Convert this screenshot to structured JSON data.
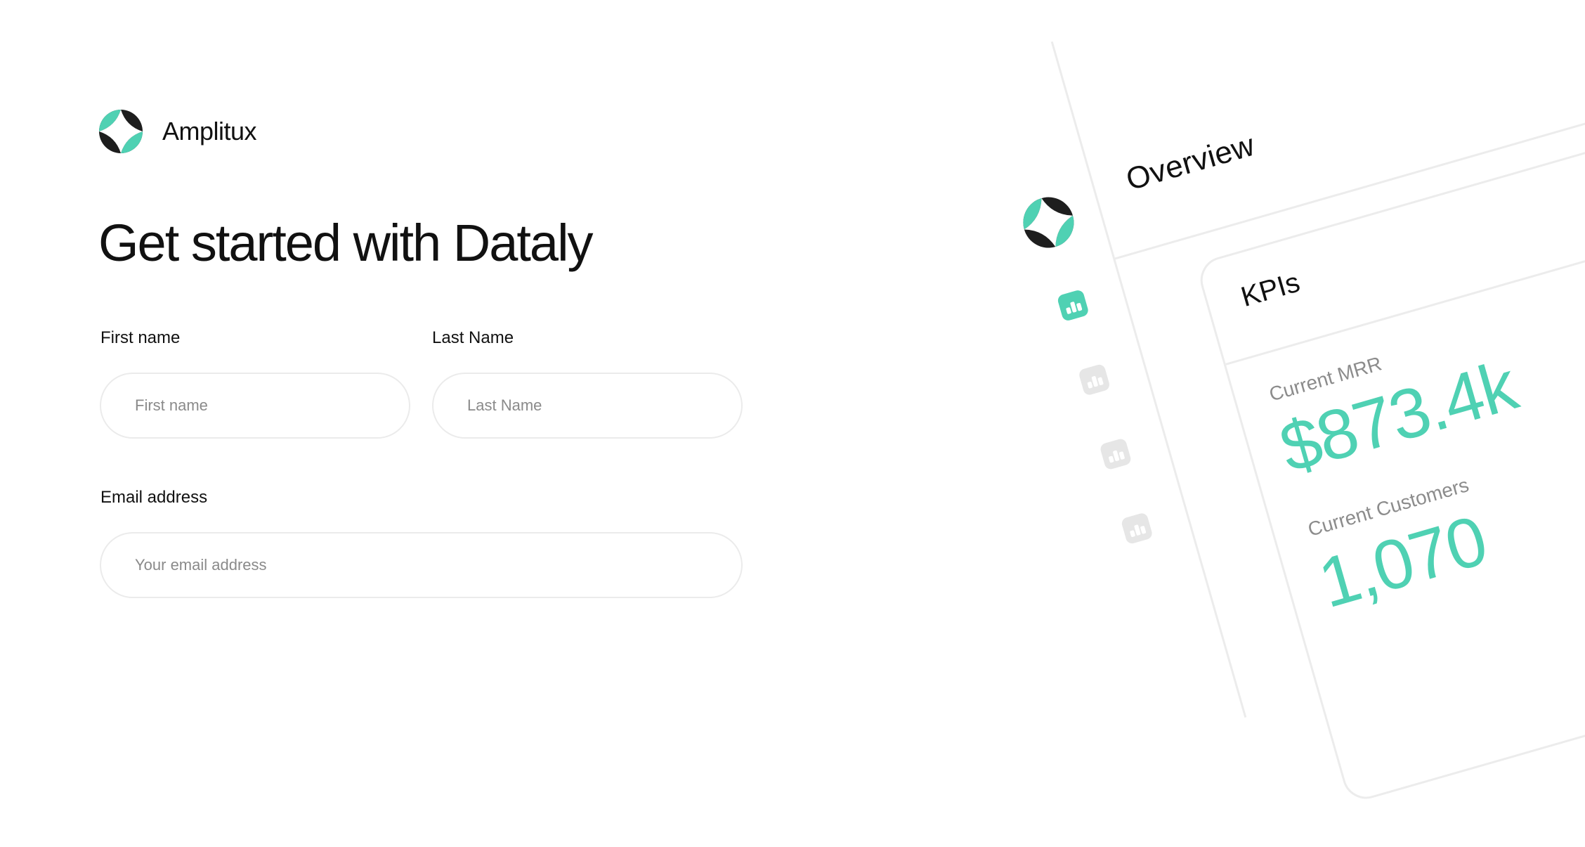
{
  "brand": {
    "name": "Amplitux",
    "logo_icon": "four-point-star-logo-icon",
    "colors": {
      "accent": "#4FD1B3",
      "dark": "#1E1E1E"
    }
  },
  "form": {
    "title": "Get started with Dataly",
    "first_name": {
      "label": "First name",
      "placeholder": "First name",
      "value": ""
    },
    "last_name": {
      "label": "Last Name",
      "placeholder": "Last Name",
      "value": ""
    },
    "email": {
      "label": "Email address",
      "placeholder": "Your email address",
      "value": ""
    }
  },
  "preview": {
    "header": {
      "title": "Overview"
    },
    "sidebar": {
      "items": [
        {
          "icon": "bar-chart-icon",
          "active": true
        },
        {
          "icon": "bar-chart-icon",
          "active": false
        },
        {
          "icon": "bar-chart-icon",
          "active": false
        },
        {
          "icon": "bar-chart-icon",
          "active": false
        }
      ]
    },
    "kpi_card": {
      "title": "KPIs",
      "metrics": [
        {
          "label": "Current MRR",
          "value": "$873.4k"
        },
        {
          "label": "Current Customers",
          "value": "1,070"
        }
      ]
    }
  }
}
